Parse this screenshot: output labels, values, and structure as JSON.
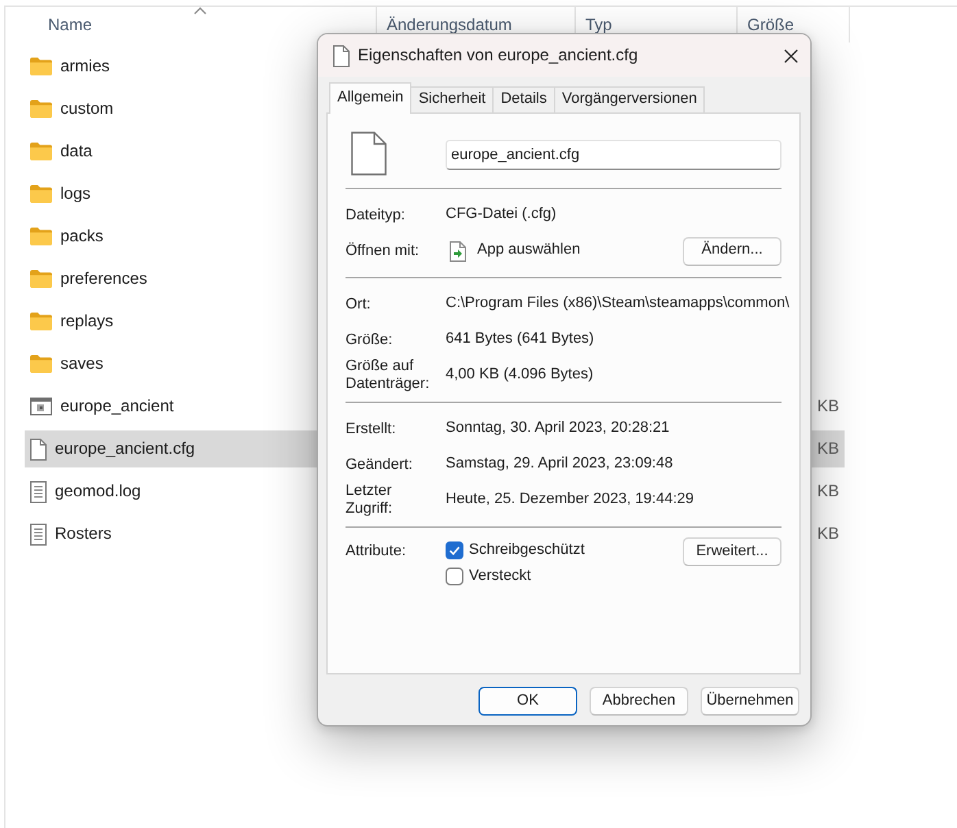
{
  "explorer": {
    "columns": [
      {
        "label": "Name",
        "sorted": true
      },
      {
        "label": "Änderungsdatum",
        "sorted": false
      },
      {
        "label": "Typ",
        "sorted": false
      },
      {
        "label": "Größe",
        "sorted": false
      }
    ],
    "rows": [
      {
        "kind": "folder",
        "name": "armies",
        "selected": false
      },
      {
        "kind": "folder",
        "name": "custom",
        "selected": false
      },
      {
        "kind": "folder",
        "name": "data",
        "selected": false
      },
      {
        "kind": "folder",
        "name": "logs",
        "selected": false
      },
      {
        "kind": "folder",
        "name": "packs",
        "selected": false
      },
      {
        "kind": "folder",
        "name": "preferences",
        "selected": false
      },
      {
        "kind": "folder",
        "name": "replays",
        "selected": false
      },
      {
        "kind": "folder",
        "name": "saves",
        "selected": false
      },
      {
        "kind": "application",
        "name": "europe_ancient",
        "size": "KB",
        "selected": false
      },
      {
        "kind": "file",
        "name": "europe_ancient.cfg",
        "size": "KB",
        "selected": true
      },
      {
        "kind": "text",
        "name": "geomod.log",
        "size": "KB",
        "selected": false
      },
      {
        "kind": "text",
        "name": "Rosters",
        "size": "KB",
        "selected": false
      }
    ]
  },
  "dialog": {
    "title": "Eigenschaften von europe_ancient.cfg",
    "tabs": [
      {
        "label": "Allgemein",
        "selected": true
      },
      {
        "label": "Sicherheit",
        "selected": false
      },
      {
        "label": "Details",
        "selected": false
      },
      {
        "label": "Vorgängerversionen",
        "selected": false
      }
    ],
    "file_name": "europe_ancient.cfg",
    "sections": [
      [
        {
          "kind": "text",
          "label": "Dateityp:",
          "value": "CFG-Datei (.cfg)"
        },
        {
          "kind": "open_with",
          "label": "Öffnen mit:",
          "value": "App auswählen",
          "button": "Ändern..."
        }
      ],
      [
        {
          "kind": "text",
          "label": "Ort:",
          "value": "C:\\Program Files (x86)\\Steam\\steamapps\\common\\"
        },
        {
          "kind": "text",
          "label": "Größe:",
          "value": "641 Bytes (641 Bytes)"
        },
        {
          "kind": "text",
          "label": "Größe auf Datenträger:",
          "value": "4,00 KB (4.096 Bytes)"
        }
      ],
      [
        {
          "kind": "text",
          "label": "Erstellt:",
          "value": "Sonntag, 30. April 2023, 20:28:21"
        },
        {
          "kind": "text",
          "label": "Geändert:",
          "value": "Samstag, 29. April 2023, 23:09:48"
        },
        {
          "kind": "text",
          "label": "Letzter Zugriff:",
          "value": "Heute, 25. Dezember 2023, 19:44:29"
        }
      ],
      [
        {
          "kind": "attributes",
          "label": "Attribute:",
          "checkboxes": [
            {
              "label": "Schreibgeschützt",
              "checked": true
            },
            {
              "label": "Versteckt",
              "checked": false
            }
          ],
          "button": "Erweitert..."
        }
      ]
    ],
    "buttons": [
      {
        "label": "OK",
        "default": true
      },
      {
        "label": "Abbrechen",
        "default": false
      },
      {
        "label": "Übernehmen",
        "default": false
      }
    ]
  }
}
